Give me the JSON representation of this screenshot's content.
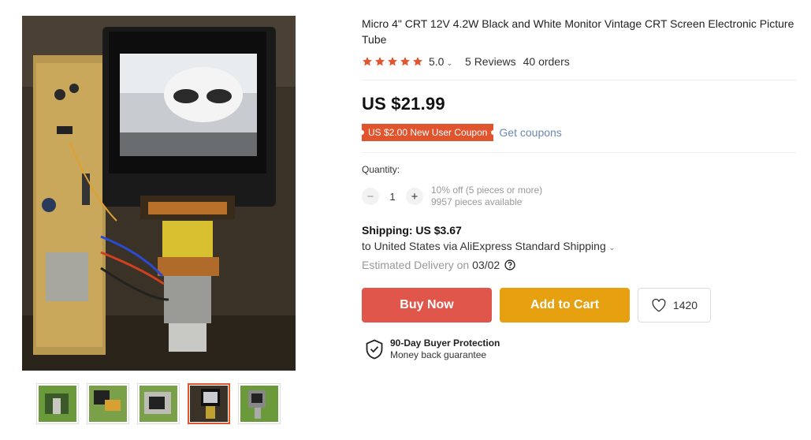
{
  "product": {
    "title": "Micro 4\" CRT 12V 4.2W Black and White Monitor Vintage CRT Screen Electronic Picture Tube",
    "rating": {
      "value": "5.0",
      "stars": 5,
      "reviews": "5 Reviews",
      "orders": "40 orders"
    },
    "price": "US $21.99",
    "coupon": {
      "badge": "US $2.00 New User Coupon",
      "link": "Get coupons"
    }
  },
  "quantity": {
    "label": "Quantity:",
    "value": "1",
    "minus": "−",
    "plus": "+",
    "discount": "10% off (5 pieces or more)",
    "available": "9957 pieces available"
  },
  "shipping": {
    "title": "Shipping: US $3.67",
    "method": "to United States via AliExpress Standard Shipping",
    "delivery_label": "Estimated Delivery on",
    "delivery_date": "03/02"
  },
  "actions": {
    "buy_now": "Buy Now",
    "add_to_cart": "Add to Cart",
    "wishlist_count": "1420"
  },
  "protection": {
    "title": "90-Day Buyer Protection",
    "subtitle": "Money back guarantee"
  },
  "gallery": {
    "thumbnail_count": 5,
    "active_index": 3
  },
  "colors": {
    "accent": "#e0542e",
    "buy": "#e0564b",
    "cart": "#e6a010",
    "star": "#e0542e",
    "link": "#6a88b0"
  }
}
